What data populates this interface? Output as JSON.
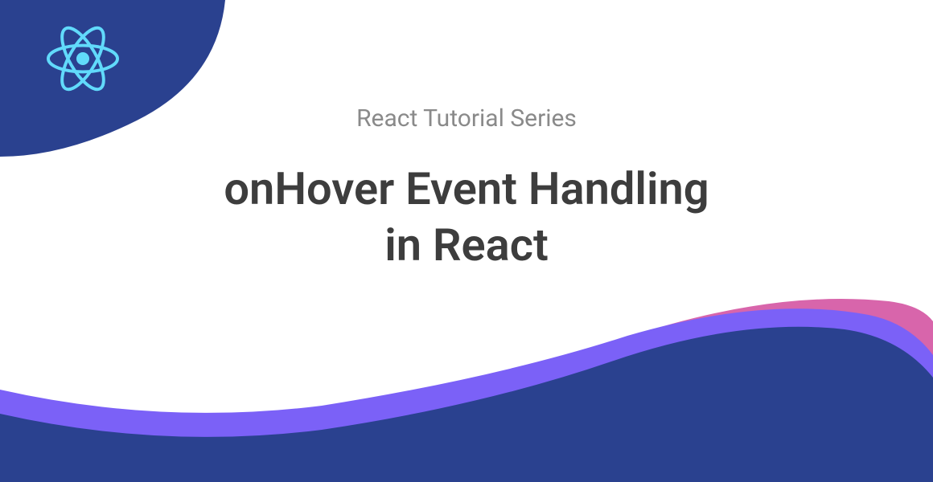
{
  "series": "React Tutorial Series",
  "title_line1": "onHover Event Handling",
  "title_line2": "in React",
  "colors": {
    "primary_blue": "#2a418f",
    "light_blue": "#61dafb",
    "purple": "#7b61f7",
    "pink": "#d865ab",
    "text_primary": "#3d3d3d",
    "text_secondary": "#8a8a8a"
  }
}
